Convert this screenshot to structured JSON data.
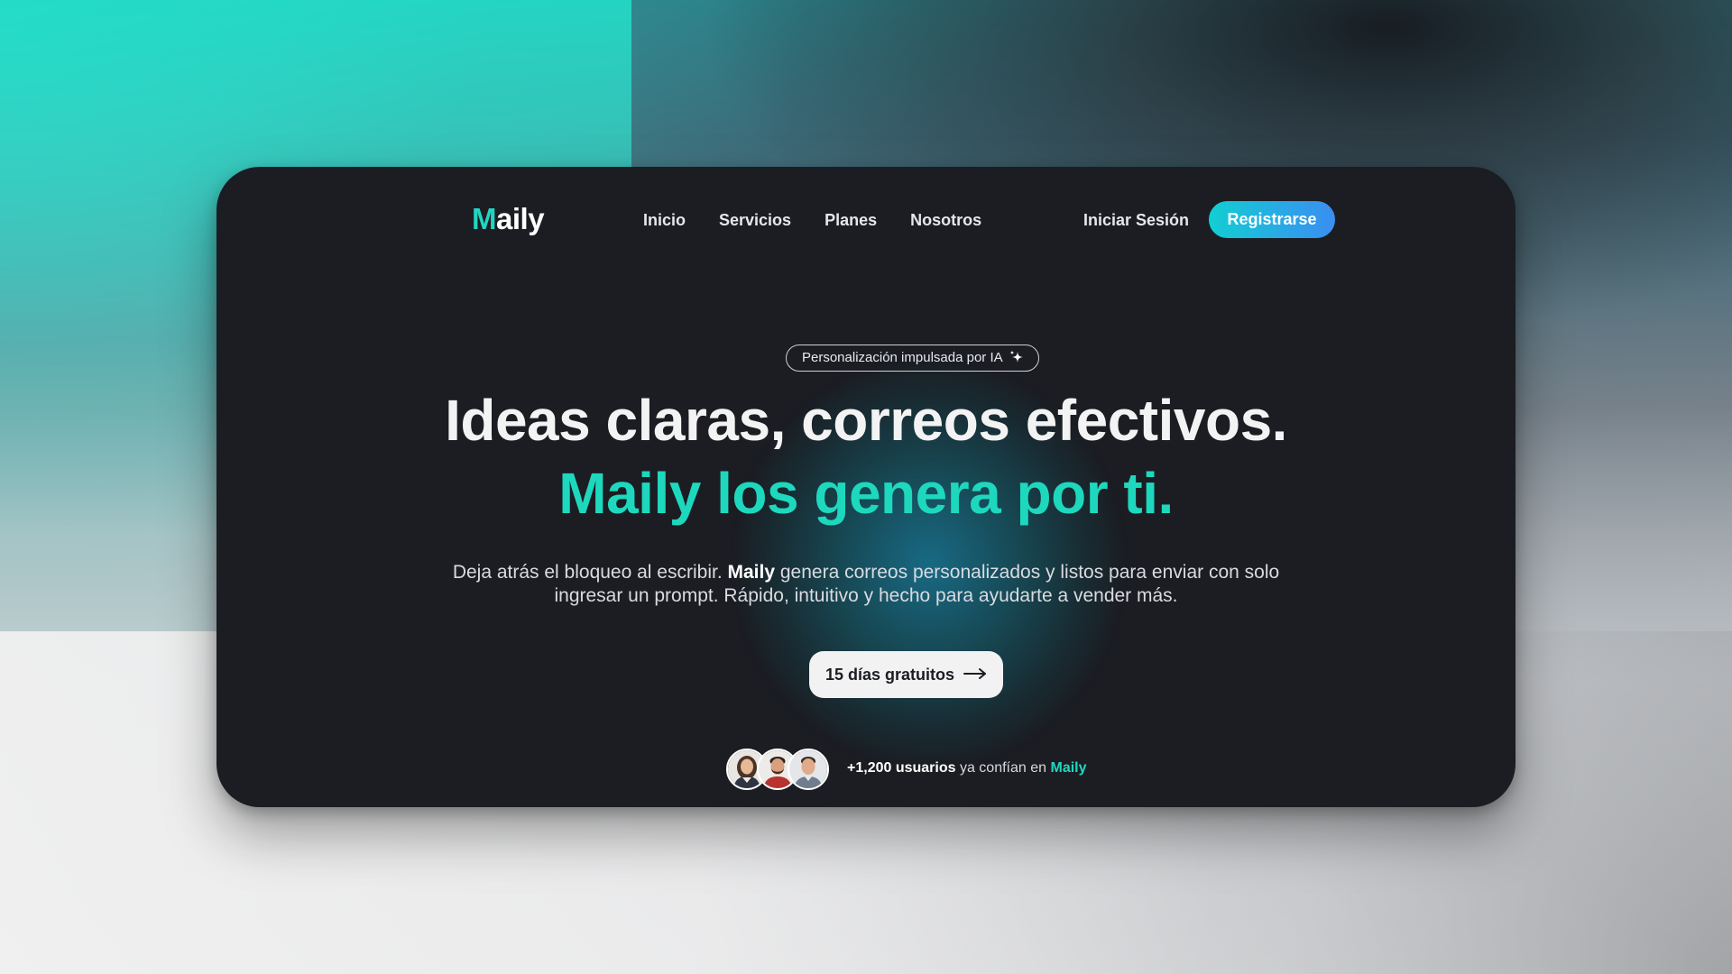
{
  "brand": {
    "logo_first": "M",
    "logo_rest": "aily",
    "accent_color": "#1ed8be"
  },
  "nav": {
    "links": [
      "Inicio",
      "Servicios",
      "Planes",
      "Nosotros"
    ],
    "login_label": "Iniciar Sesión",
    "signup_label": "Registrarse"
  },
  "hero": {
    "badge_text": "Personalización impulsada por IA",
    "badge_icon": "sparkle-icon",
    "headline_line1": "Ideas claras, correos efectivos.",
    "headline_line2": "Maily los genera por ti.",
    "desc_part1": "Deja atrás el bloqueo al escribir. ",
    "desc_brand": "Maily",
    "desc_part2": " genera correos personalizados y listos para enviar con solo ingresar un prompt. Rápido, intuitivo y hecho para ayudarte a vender más.",
    "cta_label": "15 días gratuitos",
    "cta_icon": "arrow-right-icon"
  },
  "social_proof": {
    "count_text": "+1,200 usuarios",
    "middle_text": " ya confían en ",
    "brand_text": "Maily",
    "avatars": [
      "avatar-woman",
      "avatar-man-beard",
      "avatar-man"
    ]
  }
}
